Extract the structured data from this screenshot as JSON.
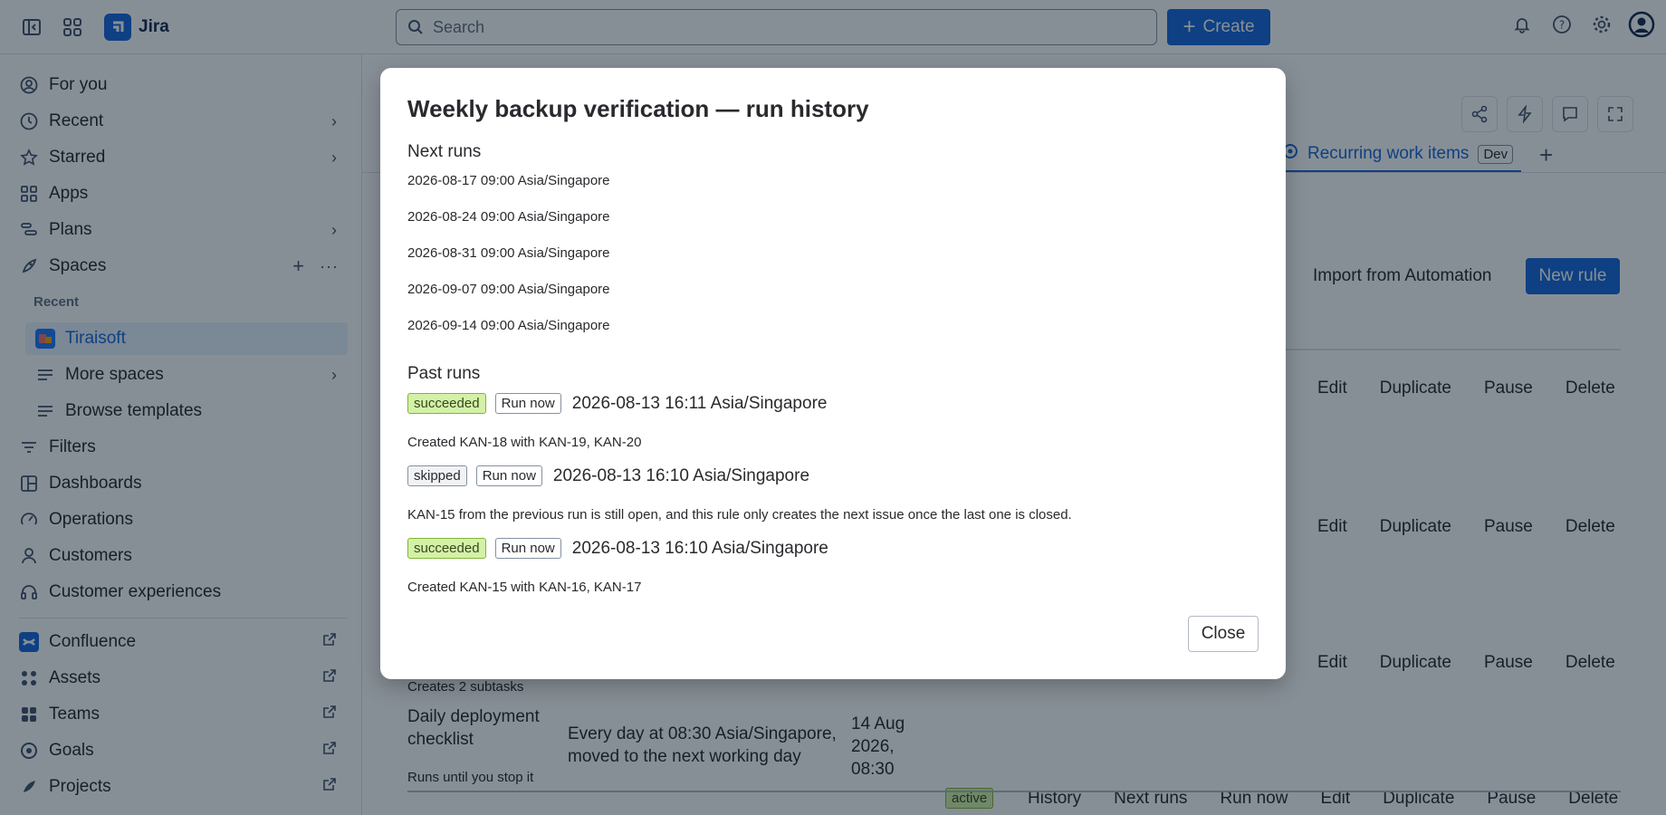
{
  "topbar": {
    "brand": "Jira",
    "search_placeholder": "Search",
    "create_label": "Create"
  },
  "sidebar": {
    "for_you": "For you",
    "recent": "Recent",
    "starred": "Starred",
    "apps": "Apps",
    "plans": "Plans",
    "spaces": "Spaces",
    "spaces_recent_header": "Recent",
    "tiraisoft": "Tiraisoft",
    "more_spaces": "More spaces",
    "browse_templates": "Browse templates",
    "filters": "Filters",
    "dashboards": "Dashboards",
    "operations": "Operations",
    "customers": "Customers",
    "customer_experiences": "Customer experiences",
    "confluence": "Confluence",
    "assets": "Assets",
    "teams": "Teams",
    "goals": "Goals",
    "projects": "Projects"
  },
  "main": {
    "tab_label": "Recurring work items",
    "tab_badge": "Dev",
    "import_label": "Import from Automation",
    "new_rule_label": "New rule",
    "actions": {
      "edit": "Edit",
      "duplicate": "Duplicate",
      "pause": "Pause",
      "delete": "Delete",
      "history": "History",
      "next_runs": "Next runs",
      "run_now": "Run now"
    },
    "partial_subtasks": "Creates 2 subtasks",
    "last_row": {
      "name": "Daily deployment checklist",
      "until": "Runs until you stop it",
      "schedule": "Every day at 08:30 Asia/Singapore, moved to the next working day",
      "next": "14 Aug 2026, 08:30",
      "status": "active"
    }
  },
  "modal": {
    "title": "Weekly backup verification — run history",
    "next_runs_heading": "Next runs",
    "next_runs": [
      "2026-08-17 09:00 Asia/Singapore",
      "2026-08-24 09:00 Asia/Singapore",
      "2026-08-31 09:00 Asia/Singapore",
      "2026-09-07 09:00 Asia/Singapore",
      "2026-09-14 09:00 Asia/Singapore"
    ],
    "past_runs_heading": "Past runs",
    "past_runs": [
      {
        "status": "succeeded",
        "run_now": "Run now",
        "time": "2026-08-13 16:11 Asia/Singapore",
        "detail": "Created KAN-18 with KAN-19, KAN-20"
      },
      {
        "status": "skipped",
        "run_now": "Run now",
        "time": "2026-08-13 16:10 Asia/Singapore",
        "detail": "KAN-15 from the previous run is still open, and this rule only creates the next issue once the last one is closed."
      },
      {
        "status": "succeeded",
        "run_now": "Run now",
        "time": "2026-08-13 16:10 Asia/Singapore",
        "detail": "Created KAN-15 with KAN-16, KAN-17"
      }
    ],
    "close_label": "Close"
  },
  "colors": {
    "accent": "#1868db",
    "success_bg": "#d3f1a7",
    "overlay": "#051524"
  }
}
